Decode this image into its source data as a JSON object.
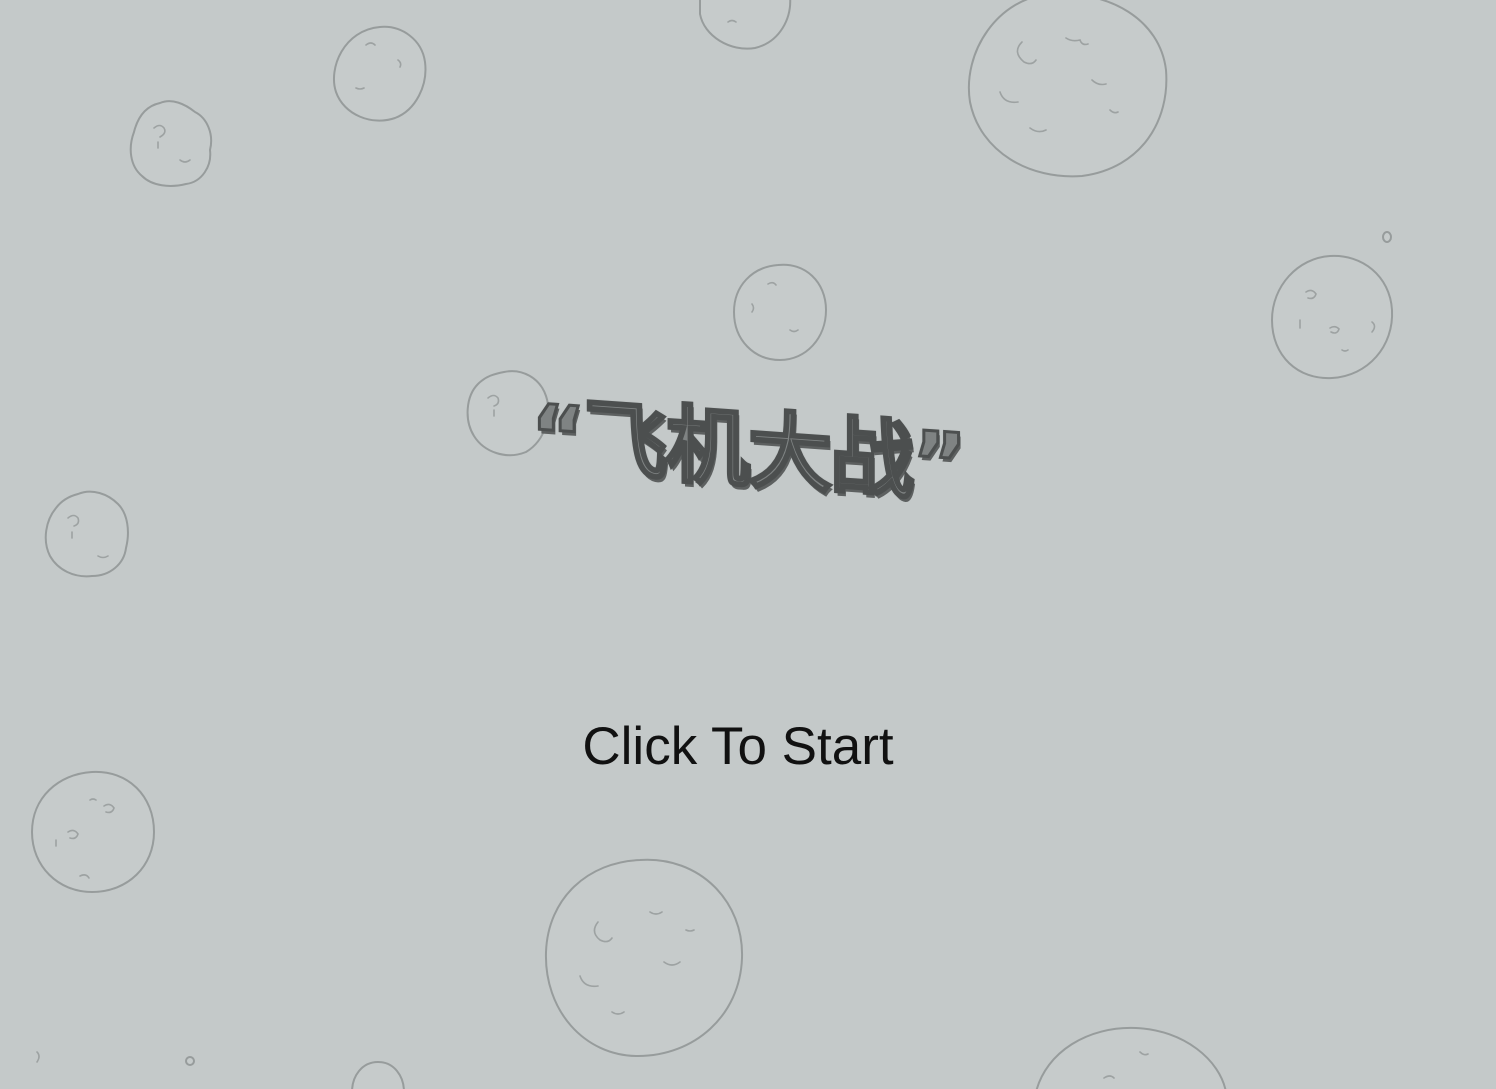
{
  "game": {
    "title": "“飞机大战”",
    "start_prompt": "Click To Start"
  },
  "colors": {
    "background": "#c4c9c9",
    "asteroid_outline": "#979c9c",
    "title_fill": "#7f8383",
    "title_outline": "#4c4f4f",
    "prompt_text": "#111111"
  },
  "background": {
    "decoration": "asteroid-field"
  }
}
